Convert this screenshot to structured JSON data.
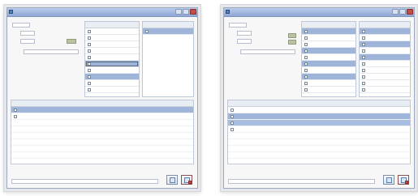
{
  "left_window": {
    "title": "",
    "top_link": "",
    "message": "",
    "footer_label": "",
    "right_button_label": "",
    "tiny_button_text": ""
  },
  "right_window": {
    "title": "",
    "top_link": "",
    "message": "",
    "footer_label": "",
    "right_button_label": "",
    "tiny_button_text": ""
  },
  "icons": {
    "app": "app-icon",
    "minimize": "minimize-icon",
    "maximize": "maximize-icon",
    "close": "close-icon",
    "checkbox": "checkbox-icon",
    "document": "document-icon",
    "search_doc": "search-document-icon"
  },
  "colors": {
    "selection": "#9eb4d8",
    "accent": "#2d5fb4",
    "warning_text": "#d44d4a",
    "title_bar": "#8fa7d4"
  }
}
